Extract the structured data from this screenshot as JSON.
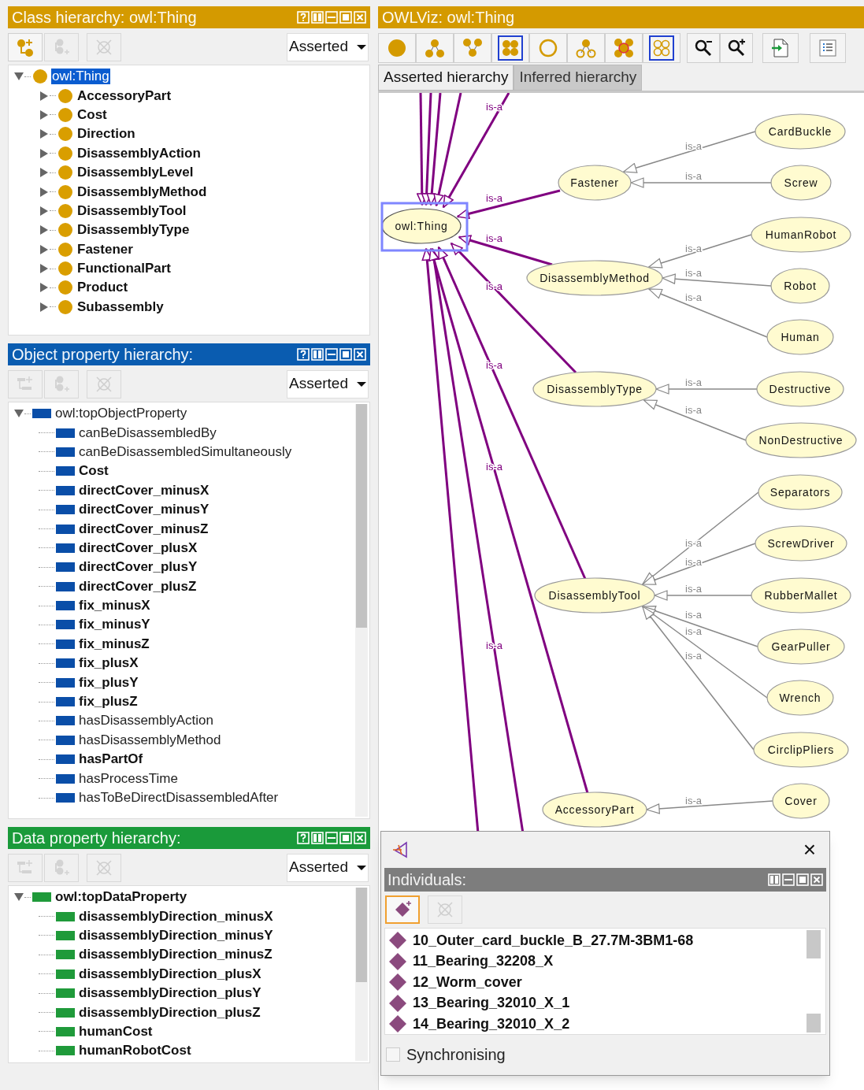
{
  "class_hierarchy": {
    "title": "Class hierarchy: owl:Thing",
    "toolbar": [
      {
        "kind": "add-subclass",
        "disabled": false
      },
      {
        "kind": "add-sibling",
        "disabled": true
      },
      {
        "kind": "delete",
        "disabled": true
      }
    ],
    "mode": "Asserted",
    "root": {
      "label": "owl:Thing",
      "expanded": true,
      "selected": true,
      "children": [
        {
          "label": "AccessoryPart",
          "expanded": false,
          "selected": false
        },
        {
          "label": "Cost",
          "expanded": false,
          "selected": false
        },
        {
          "label": "Direction",
          "expanded": false,
          "selected": false
        },
        {
          "label": "DisassemblyAction",
          "expanded": false,
          "selected": false
        },
        {
          "label": "DisassemblyLevel",
          "expanded": false,
          "selected": false
        },
        {
          "label": "DisassemblyMethod",
          "expanded": false,
          "selected": false
        },
        {
          "label": "DisassemblyTool",
          "expanded": false,
          "selected": false
        },
        {
          "label": "DisassemblyType",
          "expanded": false,
          "selected": false
        },
        {
          "label": "Fastener",
          "expanded": false,
          "selected": false
        },
        {
          "label": "FunctionalPart",
          "expanded": false,
          "selected": false
        },
        {
          "label": "Product",
          "expanded": false,
          "selected": false
        },
        {
          "label": "Subassembly",
          "expanded": false,
          "selected": false
        }
      ]
    }
  },
  "object_property_hierarchy": {
    "title": "Object property hierarchy:",
    "toolbar": [
      {
        "kind": "add-subproperty",
        "disabled": true
      },
      {
        "kind": "add-sibling",
        "disabled": true
      },
      {
        "kind": "delete",
        "disabled": true
      }
    ],
    "mode": "Asserted",
    "root": {
      "label": "owl:topObjectProperty",
      "expanded": true,
      "selected": false,
      "bold": false,
      "children": [
        {
          "label": "canBeDisassembledBy",
          "selected": false,
          "bold": false
        },
        {
          "label": "canBeDisassembledSimultaneously",
          "selected": false,
          "bold": false
        },
        {
          "label": "Cost",
          "selected": false,
          "bold": true
        },
        {
          "label": "directCover_minusX",
          "selected": false,
          "bold": true
        },
        {
          "label": "directCover_minusY",
          "selected": false,
          "bold": true
        },
        {
          "label": "directCover_minusZ",
          "selected": false,
          "bold": true
        },
        {
          "label": "directCover_plusX",
          "selected": false,
          "bold": true
        },
        {
          "label": "directCover_plusY",
          "selected": false,
          "bold": true
        },
        {
          "label": "directCover_plusZ",
          "selected": false,
          "bold": true
        },
        {
          "label": "fix_minusX",
          "selected": false,
          "bold": true
        },
        {
          "label": "fix_minusY",
          "selected": false,
          "bold": true
        },
        {
          "label": "fix_minusZ",
          "selected": false,
          "bold": true
        },
        {
          "label": "fix_plusX",
          "selected": false,
          "bold": true
        },
        {
          "label": "fix_plusY",
          "selected": false,
          "bold": true
        },
        {
          "label": "fix_plusZ",
          "selected": false,
          "bold": true
        },
        {
          "label": "hasDisassemblyAction",
          "selected": false,
          "bold": false
        },
        {
          "label": "hasDisassemblyMethod",
          "selected": false,
          "bold": false
        },
        {
          "label": "hasPartOf",
          "selected": false,
          "bold": true
        },
        {
          "label": "hasProcessTime",
          "selected": false,
          "bold": false
        },
        {
          "label": "hasToBeDirectDisassembledAfter",
          "selected": false,
          "bold": false
        }
      ]
    }
  },
  "data_property_hierarchy": {
    "title": "Data property hierarchy:",
    "toolbar": [
      {
        "kind": "add-subproperty",
        "disabled": true
      },
      {
        "kind": "add-sibling",
        "disabled": true
      },
      {
        "kind": "delete",
        "disabled": true
      }
    ],
    "mode": "Asserted",
    "root": {
      "label": "owl:topDataProperty",
      "expanded": true,
      "selected": false,
      "bold": true,
      "children": [
        {
          "label": "disassemblyDirection_minusX",
          "selected": false,
          "bold": true
        },
        {
          "label": "disassemblyDirection_minusY",
          "selected": false,
          "bold": true
        },
        {
          "label": "disassemblyDirection_minusZ",
          "selected": false,
          "bold": true
        },
        {
          "label": "disassemblyDirection_plusX",
          "selected": false,
          "bold": true
        },
        {
          "label": "disassemblyDirection_plusY",
          "selected": false,
          "bold": true
        },
        {
          "label": "disassemblyDirection_plusZ",
          "selected": false,
          "bold": true
        },
        {
          "label": "humanCost",
          "selected": false,
          "bold": true
        },
        {
          "label": "humanRobotCost",
          "selected": false,
          "bold": true
        }
      ]
    }
  },
  "owlviz": {
    "title": "OWLViz: owl:Thing",
    "toolbar": [
      [
        {
          "kind": "show-class",
          "selected": false
        },
        {
          "kind": "show-subclasses",
          "selected": false
        },
        {
          "kind": "show-superclasses",
          "selected": false
        },
        {
          "kind": "show-all",
          "selected": true
        },
        {
          "kind": "hide-class",
          "selected": false
        },
        {
          "kind": "hide-subclasses",
          "selected": false
        },
        {
          "kind": "hide-class-node",
          "selected": false
        },
        {
          "kind": "hide-all",
          "selected": true
        }
      ],
      [
        {
          "kind": "zoom-out"
        },
        {
          "kind": "zoom-in"
        }
      ],
      [
        {
          "kind": "export"
        }
      ],
      [
        {
          "kind": "options"
        }
      ]
    ],
    "tabs": [
      {
        "label": "Asserted hierarchy",
        "selected": true
      },
      {
        "label": "Inferred hierarchy",
        "selected": false
      }
    ],
    "graph": {
      "root": {
        "label": "owl:Thing",
        "selected": true
      },
      "offscreen_edge_labels": [
        "is-a",
        "is-a"
      ],
      "children": [
        {
          "label": "Fastener",
          "selected": false,
          "edge_label": "is-a",
          "children": [
            {
              "label": "CardBuckle",
              "selected": false,
              "edge_label": "is-a"
            },
            {
              "label": "Screw",
              "selected": false,
              "edge_label": "is-a"
            }
          ]
        },
        {
          "label": "DisassemblyMethod",
          "selected": false,
          "edge_label": "is-a",
          "children": [
            {
              "label": "HumanRobot",
              "selected": false,
              "edge_label": "is-a"
            },
            {
              "label": "Robot",
              "selected": false,
              "edge_label": "is-a"
            },
            {
              "label": "Human",
              "selected": false,
              "edge_label": "is-a"
            }
          ]
        },
        {
          "label": "DisassemblyType",
          "selected": false,
          "edge_label": "is-a",
          "children": [
            {
              "label": "Destructive",
              "selected": false,
              "edge_label": "is-a"
            },
            {
              "label": "NonDestructive",
              "selected": false,
              "edge_label": "is-a"
            }
          ]
        },
        {
          "label": "DisassemblyTool",
          "selected": false,
          "edge_label": "is-a",
          "children": [
            {
              "label": "Separators",
              "selected": false,
              "edge_label": "is-a"
            },
            {
              "label": "ScrewDriver",
              "selected": false,
              "edge_label": "is-a"
            },
            {
              "label": "RubberMallet",
              "selected": false,
              "edge_label": "is-a"
            },
            {
              "label": "GearPuller",
              "selected": false,
              "edge_label": "is-a"
            },
            {
              "label": "Wrench",
              "selected": false,
              "edge_label": "is-a"
            },
            {
              "label": "CirclipPliers",
              "selected": false,
              "edge_label": "is-a"
            }
          ]
        },
        {
          "label": "AccessoryPart",
          "selected": false,
          "edge_label": "is-a",
          "children": [
            {
              "label": "Cover",
              "selected": false,
              "edge_label": "is-a"
            }
          ]
        }
      ]
    }
  },
  "individuals_window": {
    "close": "×",
    "title": "Individuals:",
    "toolbar": [
      {
        "kind": "add-individual",
        "disabled": false
      },
      {
        "kind": "delete",
        "disabled": true
      }
    ],
    "items": [
      {
        "label": "10_Outer_card_buckle_B_27.7M-3BM1-68",
        "selected": false
      },
      {
        "label": "11_Bearing_32208_X",
        "selected": false
      },
      {
        "label": "12_Worm_cover",
        "selected": false
      },
      {
        "label": "13_Bearing_32010_X_1",
        "selected": false
      },
      {
        "label": "14_Bearing_32010_X_2",
        "selected": false
      }
    ],
    "synchronising": {
      "label": "Synchronising",
      "checked": false
    }
  }
}
